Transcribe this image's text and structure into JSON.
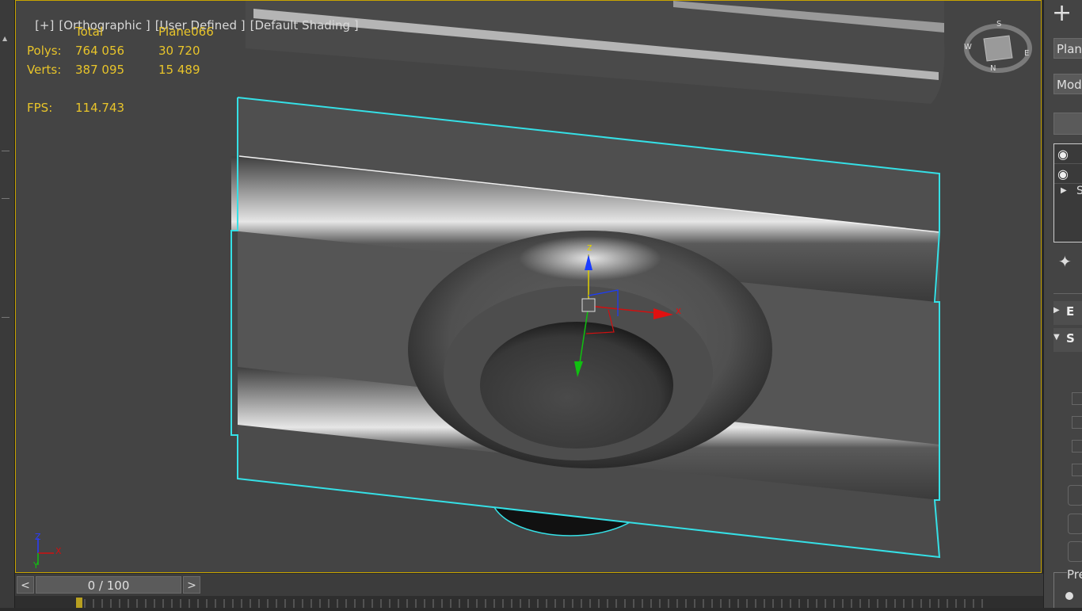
{
  "viewport": {
    "labels": [
      "[+]",
      "[Orthographic ]",
      "[User Defined ]",
      "[Default Shading ]"
    ],
    "stats": {
      "col_total": "Total",
      "col_object": "Plane066",
      "polys_label": "Polys:",
      "polys_total": "764 056",
      "polys_object": "30 720",
      "verts_label": "Verts:",
      "verts_total": "387 095",
      "verts_object": "15 489",
      "fps_label": "FPS:",
      "fps_value": "114.743"
    },
    "gizmo": {
      "z": "z",
      "x": "x"
    },
    "axis_tripod": {
      "z": "Z",
      "x": "X",
      "y": "Y"
    },
    "viewcube": {
      "top": "S",
      "left": "W",
      "right": "E",
      "bottom": "N"
    }
  },
  "right_panel": {
    "create_icon": "plus-icon",
    "object_name": "Plane",
    "modifier_list": "Modi",
    "stack_item_3": "S",
    "rollout_1": "E",
    "rollout_2": "S",
    "preview_label": "Pre"
  },
  "timeline": {
    "prev": "<",
    "next": ">",
    "frame": "0 / 100"
  },
  "colors": {
    "selection": "#35e0e6",
    "stats_text": "#e8c42a",
    "viewport_border": "#c8a400"
  }
}
